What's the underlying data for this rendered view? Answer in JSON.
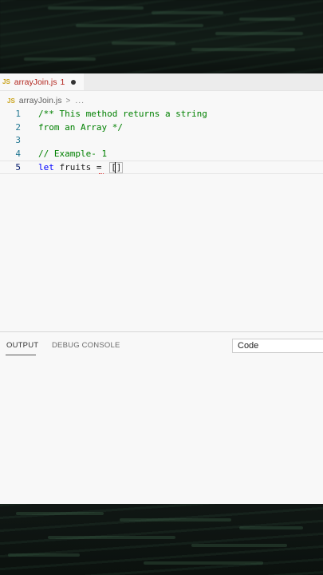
{
  "tab": {
    "badge": "JS",
    "filename": "arrayJoin.js",
    "problem_count": "1"
  },
  "breadcrumb": {
    "badge": "JS",
    "file": "arrayJoin.js",
    "separator": ">",
    "more": "..."
  },
  "editor": {
    "lines": [
      {
        "number": "1",
        "text": "/** This method returns a string",
        "kind": "comment"
      },
      {
        "number": "2",
        "text": "from an Array */",
        "kind": "comment"
      },
      {
        "number": "3",
        "text": "",
        "kind": "plain"
      },
      {
        "number": "4",
        "text": "// Example- 1",
        "kind": "comment"
      },
      {
        "number": "5",
        "keyword": "let",
        "text": " fruits = ",
        "bracket": "[]",
        "kind": "code"
      }
    ]
  },
  "panel": {
    "tabs": [
      "OUTPUT",
      "DEBUG CONSOLE"
    ],
    "active_tab": "OUTPUT",
    "channel_select": "Code"
  },
  "colors": {
    "comment": "#008000",
    "keyword": "#0000ff",
    "line_number": "#237893",
    "error": "#b3261e",
    "js_badge": "#c9a21a"
  }
}
